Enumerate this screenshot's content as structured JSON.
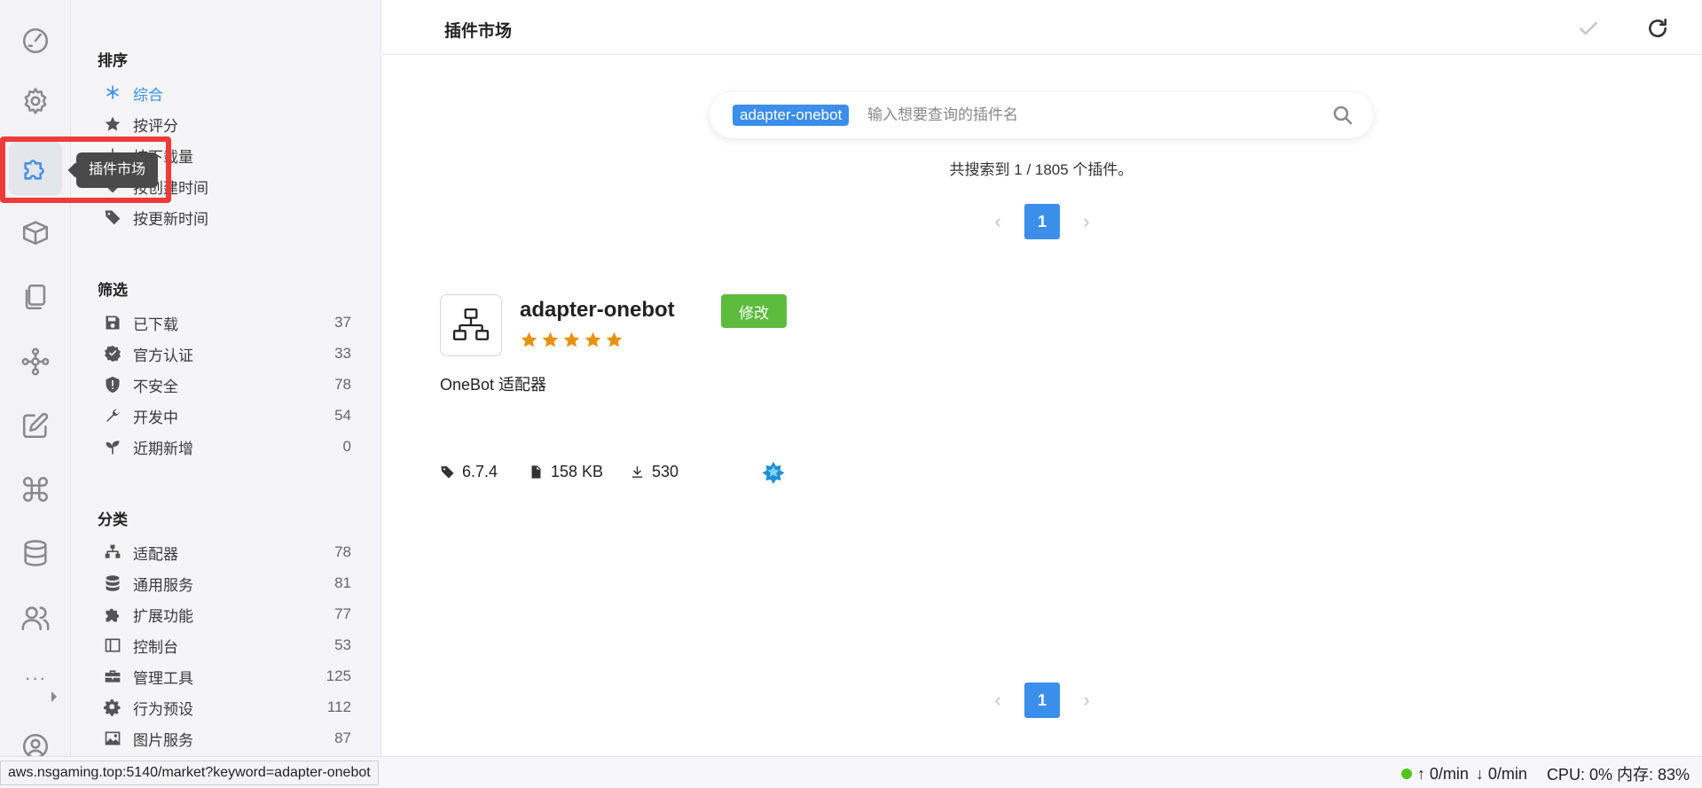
{
  "activity_bar": {
    "items": [
      {
        "name": "dashboard-icon"
      },
      {
        "name": "settings-icon"
      },
      {
        "name": "puzzle-icon",
        "active": true
      },
      {
        "name": "package-icon"
      },
      {
        "name": "files-icon"
      },
      {
        "name": "network-icon"
      },
      {
        "name": "edit-icon"
      },
      {
        "name": "command-icon"
      },
      {
        "name": "database-icon"
      },
      {
        "name": "users-icon"
      }
    ],
    "more_label": "···",
    "tooltip": "插件市场",
    "accent": "#4a90e2",
    "highlight_color": "#f03a3a"
  },
  "sidebar": {
    "sort_title": "排序",
    "sort_items": [
      {
        "label": "综合",
        "icon": "asterisk-icon",
        "active": true
      },
      {
        "label": "按评分",
        "icon": "star-icon"
      },
      {
        "label": "按下载量",
        "icon": "download-icon"
      },
      {
        "label": "按创建时间",
        "icon": "heart-icon"
      },
      {
        "label": "按更新时间",
        "icon": "tag-icon"
      }
    ],
    "filter_title": "筛选",
    "filter_items": [
      {
        "label": "已下载",
        "count": "37",
        "icon": "save-icon"
      },
      {
        "label": "官方认证",
        "count": "33",
        "icon": "verified-icon"
      },
      {
        "label": "不安全",
        "count": "78",
        "icon": "shield-alert-icon"
      },
      {
        "label": "开发中",
        "count": "54",
        "icon": "wrench-icon"
      },
      {
        "label": "近期新增",
        "count": "0",
        "icon": "seedling-icon"
      }
    ],
    "category_title": "分类",
    "category_items": [
      {
        "label": "适配器",
        "count": "78",
        "icon": "sitemap-icon"
      },
      {
        "label": "通用服务",
        "count": "81",
        "icon": "database-icon"
      },
      {
        "label": "扩展功能",
        "count": "77",
        "icon": "puzzle-icon"
      },
      {
        "label": "控制台",
        "count": "53",
        "icon": "console-icon"
      },
      {
        "label": "管理工具",
        "count": "125",
        "icon": "toolbox-icon"
      },
      {
        "label": "行为预设",
        "count": "112",
        "icon": "gear-icon"
      },
      {
        "label": "图片服务",
        "count": "87",
        "icon": "image-icon"
      }
    ]
  },
  "header": {
    "title": "插件市场",
    "confirm_icon": "check-icon",
    "refresh_icon": "refresh-icon"
  },
  "search": {
    "tag": "adapter-onebot",
    "placeholder": "输入想要查询的插件名",
    "value": ""
  },
  "results": {
    "summary": "共搜索到 1 / 1805 个插件。",
    "current_page": "1",
    "prev": "‹",
    "next": "›"
  },
  "plugin": {
    "name": "adapter-onebot",
    "rating": 5,
    "edit_label": "修改",
    "description": "OneBot 适配器",
    "version": "6.7.4",
    "size": "158 KB",
    "downloads": "530",
    "colors": {
      "edit": "#5dbb3e",
      "star": "#e8920c"
    }
  },
  "statusbar": {
    "url": "aws.nsgaming.top:5140/market?keyword=adapter-onebot",
    "status_color": "#52c41a",
    "upload": "↑ 0/min",
    "download": "↓ 0/min",
    "cpu_mem": "CPU: 0% 内存: 83%"
  }
}
